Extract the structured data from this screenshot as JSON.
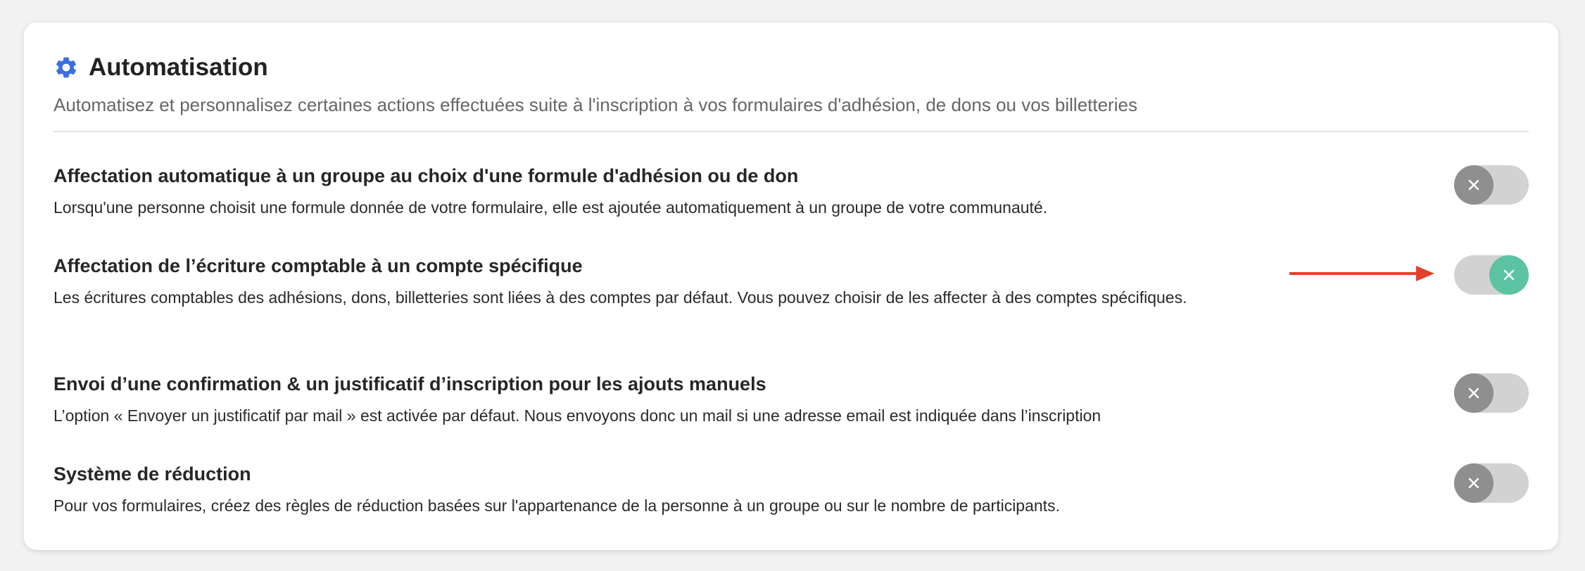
{
  "header": {
    "title": "Automatisation",
    "subtitle": "Automatisez et personnalisez certaines actions effectuées suite à l'inscription à vos formulaires d'adhésion, de dons ou vos billetteries"
  },
  "colors": {
    "accent": "#3b6fe0",
    "toggle_on": "#5cc3a2",
    "toggle_off_knob": "#8f8f8f",
    "arrow": "#e4402c"
  },
  "settings": [
    {
      "title": "Affectation automatique à un groupe au choix d'une formule d'adhésion ou de don",
      "description": "Lorsqu'une personne choisit une formule donnée de votre formulaire, elle est ajoutée automatiquement à un groupe de votre communauté.",
      "enabled": false
    },
    {
      "title": "Affectation de l’écriture comptable à un compte spécifique",
      "description": "Les écritures comptables des adhésions, dons, billetteries sont liées à des comptes par défaut. Vous pouvez choisir de les affecter à des comptes spécifiques.",
      "enabled": true
    },
    {
      "title": "Envoi d’une confirmation & un justificatif d’inscription pour les ajouts manuels",
      "description": "L’option « Envoyer un justificatif par mail » est activée par défaut. Nous envoyons donc un mail si une adresse email est indiquée dans l’inscription",
      "enabled": false
    },
    {
      "title": "Système de réduction",
      "description": "Pour vos formulaires, créez des règles de réduction basées sur l'appartenance de la personne à un groupe ou sur le nombre de participants.",
      "enabled": false
    }
  ],
  "icons": {
    "header": "gear-icon",
    "toggle_knob": "close-icon",
    "annotation": "arrow-right-icon"
  }
}
